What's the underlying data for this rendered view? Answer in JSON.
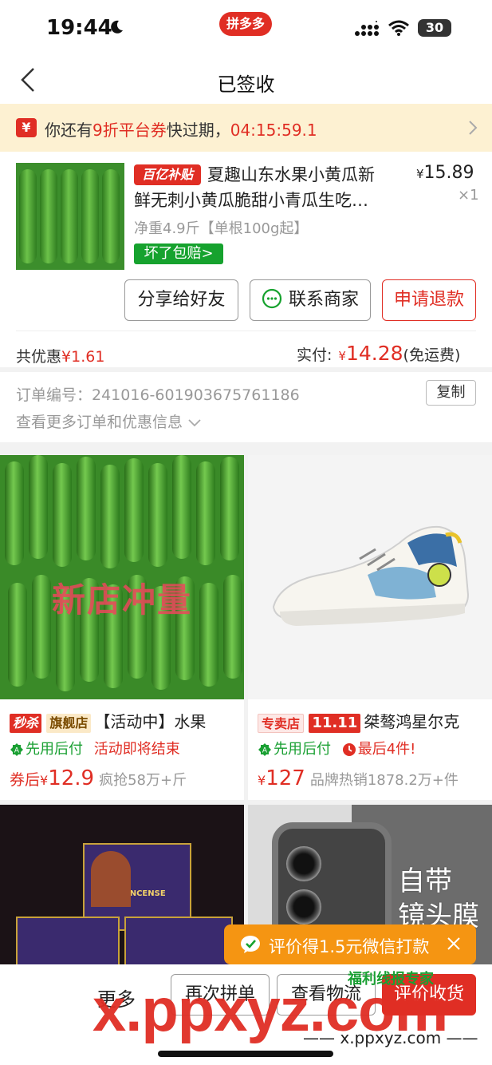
{
  "status_bar": {
    "time": "19:44",
    "app_badge": "拼多多",
    "battery": "30"
  },
  "nav": {
    "title": "已签收"
  },
  "coupon_bar": {
    "icon_text": "¥",
    "prefix": "你还有",
    "highlight": "9折平台券",
    "suffix": "快过期，",
    "countdown": "04:15:59.1"
  },
  "order_item": {
    "subsidy_tag": "百亿补贴",
    "title_line1": "夏趣山东水果小黄瓜新",
    "title_line2": "鲜无刺小黄瓜脆甜小青瓜生吃…",
    "price_symbol": "¥",
    "price": "15.89",
    "quantity": "×1",
    "spec": "净重4.9斤【单根100g起】",
    "guarantee": "坏了包赔>"
  },
  "order_actions": {
    "share_label": "分享给好友",
    "contact_label": "联系商家",
    "refund_label": "申请退款"
  },
  "order_summary": {
    "discount_label": "共优惠",
    "discount_value": "¥1.61",
    "paid_label": "实付:",
    "paid_symbol": "¥",
    "paid_amount": "14.28",
    "shipping_note": "(免运费)"
  },
  "order_info": {
    "order_no_label": "订单编号：241016-601903675761186",
    "copy_label": "复制",
    "more_label": "查看更多订单和优惠信息"
  },
  "recommendations": [
    {
      "overlay": "新店冲量",
      "tags": [
        "秒杀",
        "旗舰店"
      ],
      "title": "【活动中】水果",
      "pay_later": "先用后付",
      "note": "活动即将结束",
      "price_prefix": "券后",
      "price_symbol": "¥",
      "price": "12.9",
      "sold": "疯抢58万+斤"
    },
    {
      "tags": [
        "专卖店",
        "11.11"
      ],
      "title": "桀骜鸿星尔克",
      "pay_later": "先用后付",
      "note": "最后4件!",
      "price_prefix": "",
      "price_symbol": "¥",
      "price": "127",
      "sold": "品牌热销1878.2万+件"
    },
    {
      "box_text": "RAJ INCENSE"
    },
    {
      "ad_text_line1": "自带",
      "ad_text_line2": "镜头膜"
    }
  ],
  "review_popup": {
    "text": "评价得1.5元微信打款"
  },
  "bottom_bar": {
    "more_label": "更多",
    "rebuy_label": "再次拼单",
    "logistics_label": "查看物流",
    "review_label": "评价收货"
  },
  "watermarks": {
    "big": "x.ppxyz.com",
    "small": "福利线报专家",
    "url": "—— x.ppxyz.com ——"
  },
  "colors": {
    "brand_red": "#e02e24",
    "green": "#16a22e",
    "coupon_bg": "#fdf1d2",
    "popup_orange": "#f59512"
  }
}
